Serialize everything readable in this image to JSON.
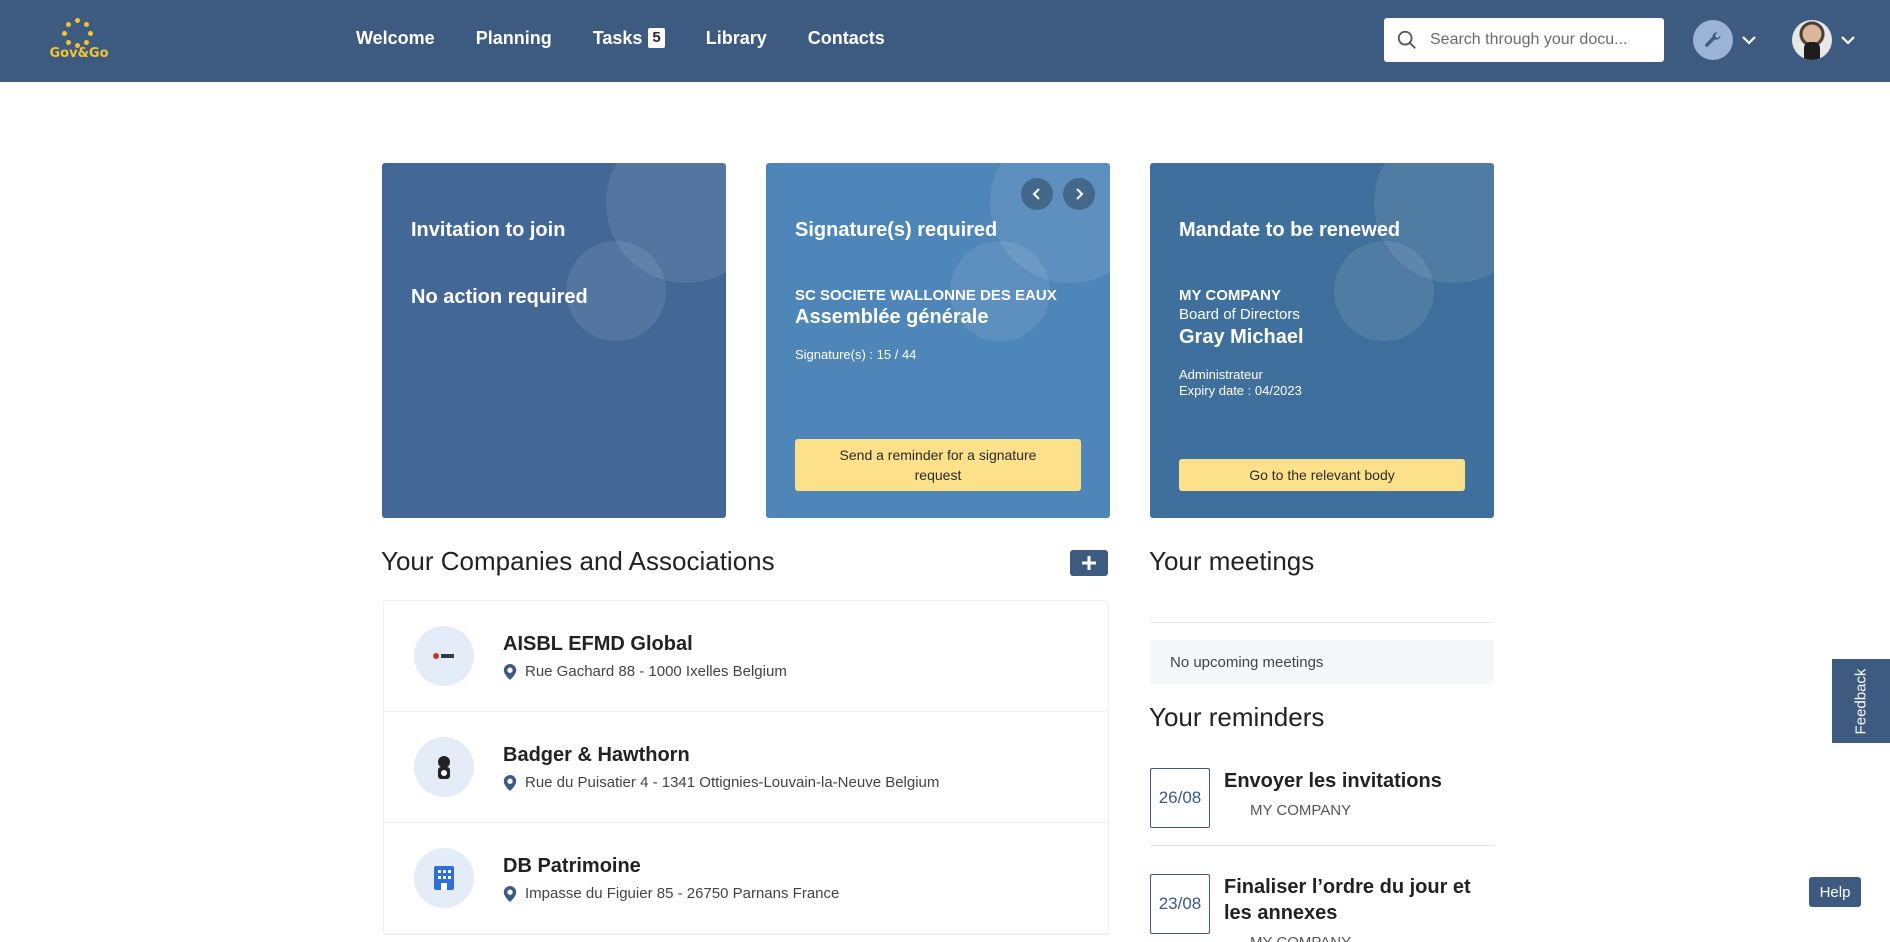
{
  "header": {
    "logo_text": "Gov&Go",
    "nav": [
      {
        "label": "Welcome"
      },
      {
        "label": "Planning"
      },
      {
        "label": "Tasks",
        "badge": "5"
      },
      {
        "label": "Library"
      },
      {
        "label": "Contacts"
      }
    ],
    "search": {
      "placeholder": "Search through your docu..."
    },
    "icons": {
      "search": "search-icon",
      "tools": "wrench-icon",
      "chevron": "chevron-down-icon"
    },
    "colors": {
      "bar": "#3d5a80",
      "logo": "#f4c430"
    }
  },
  "cards": [
    {
      "title": "Invitation to join",
      "subtitle": "No action required",
      "color": "#436897"
    },
    {
      "title": "Signature(s) required",
      "organization": "SC SOCIETE WALLONNE DES EAUX",
      "meeting": "Assemblée générale",
      "signatures": "Signature(s) : 15 / 44",
      "button": "Send a reminder for a signature request",
      "color": "#4f86b9"
    },
    {
      "title": "Mandate to be renewed",
      "organization": "MY COMPANY",
      "body": "Board of Directors",
      "person": "Gray Michael",
      "role": "Administrateur",
      "expiry": "Expiry date : 04/2023",
      "button": "Go to the relevant body",
      "color": "#3f6f9c"
    }
  ],
  "companies": {
    "title": "Your Companies and Associations",
    "items": [
      {
        "name": "AISBL EFMD Global",
        "address": "Rue Gachard 88 - 1000 Ixelles Belgium"
      },
      {
        "name": "Badger & Hawthorn",
        "address": "Rue du Puisatier 4 - 1341 Ottignies-Louvain-la-Neuve Belgium"
      },
      {
        "name": "DB Patrimoine",
        "address": "Impasse du Figuier 85 - 26750 Parnans France"
      }
    ]
  },
  "meetings": {
    "title": "Your meetings",
    "empty": "No upcoming meetings"
  },
  "reminders": {
    "title": "Your reminders",
    "items": [
      {
        "date": "26/08",
        "title": "Envoyer les invitations",
        "company": "MY COMPANY"
      },
      {
        "date": "23/08",
        "title": "Finaliser l’ordre du jour et les annexes",
        "company": "MY COMPANY"
      }
    ]
  },
  "feedback": "Feedback",
  "help": "Help"
}
